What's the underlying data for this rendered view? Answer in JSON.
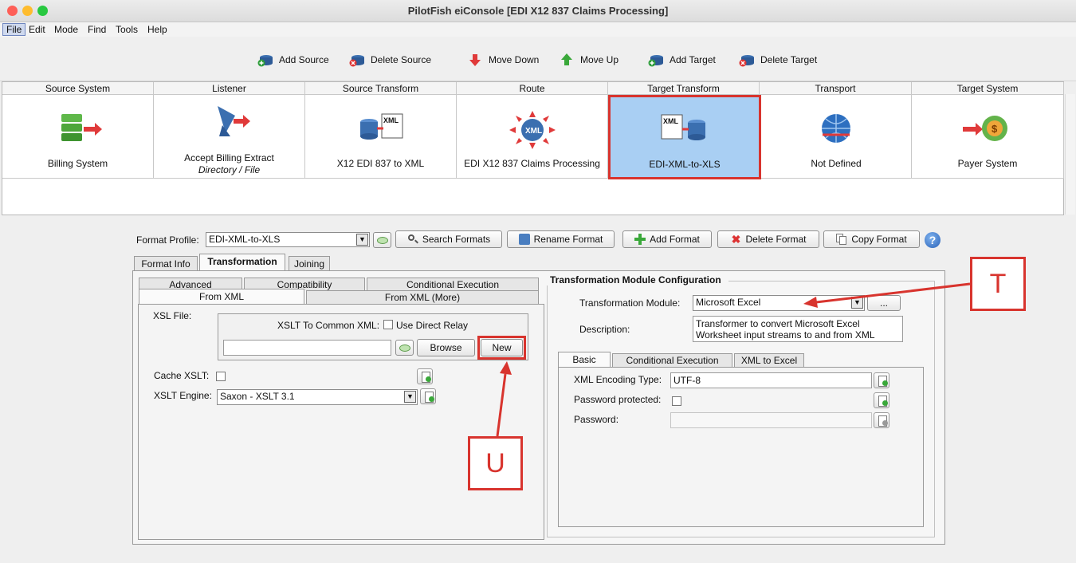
{
  "window": {
    "title": "PilotFish eiConsole [EDI X12 837 Claims Processing]"
  },
  "menu": [
    "File",
    "Edit",
    "Mode",
    "Find",
    "Tools",
    "Help"
  ],
  "toolbar": {
    "add_source": "Add Source",
    "delete_source": "Delete Source",
    "move_down": "Move Down",
    "move_up": "Move Up",
    "add_target": "Add Target",
    "delete_target": "Delete Target"
  },
  "route_grid": {
    "columns": [
      "Source System",
      "Listener",
      "Source Transform",
      "Route",
      "Target Transform",
      "Transport",
      "Target System"
    ],
    "cells": [
      {
        "label": "Billing System",
        "icon": "server-stack-icon"
      },
      {
        "label": "Accept Billing Extract",
        "sublabel": "Directory / File",
        "icon": "satellite-dish-icon"
      },
      {
        "label": "X12 EDI 837 to XML",
        "icon": "xml-transform-icon",
        "badge": "XML"
      },
      {
        "label": "EDI X12 837 Claims Processing",
        "icon": "xml-route-icon",
        "badge": "XML"
      },
      {
        "label": "EDI-XML-to-XLS",
        "icon": "xml-transform-icon",
        "badge": "XML",
        "selected": true
      },
      {
        "label": "Not Defined",
        "icon": "globe-icon"
      },
      {
        "label": "Payer System",
        "icon": "payer-icon"
      }
    ]
  },
  "format_profile": {
    "label": "Format Profile:",
    "value": "EDI-XML-to-XLS",
    "search": "Search Formats",
    "rename": "Rename Format",
    "add": "Add Format",
    "delete": "Delete Format",
    "copy": "Copy Format"
  },
  "main_tabs": [
    "Format Info",
    "Transformation",
    "Joining"
  ],
  "left_panel": {
    "tabs_row1": [
      "Advanced",
      "Compatibility",
      "Conditional Execution"
    ],
    "tabs_row2": [
      "From XML",
      "From XML (More)"
    ],
    "xsl_file_label": "XSL File:",
    "xslt_common_label": "XSLT To Common XML:",
    "direct_relay_label": "Use Direct Relay",
    "browse": "Browse",
    "new": "New",
    "cache_label": "Cache XSLT:",
    "engine_label": "XSLT Engine:",
    "engine_value": "Saxon - XSLT 3.1"
  },
  "right_panel": {
    "heading": "Transformation Module Configuration",
    "module_label": "Transformation Module:",
    "module_value": "Microsoft Excel",
    "ellipsis": "...",
    "description_label": "Description:",
    "description_value": "Transformer to convert Microsoft Excel Worksheet input streams to and from XML",
    "tabs": [
      "Basic",
      "Conditional Execution",
      "XML to Excel"
    ],
    "encoding_label": "XML Encoding Type:",
    "encoding_value": "UTF-8",
    "password_protected_label": "Password protected:",
    "password_label": "Password:"
  },
  "annotations": {
    "t": "T",
    "u": "U"
  },
  "colors": {
    "annotation_red": "#d8342e",
    "selection_blue": "#a9cff3"
  }
}
